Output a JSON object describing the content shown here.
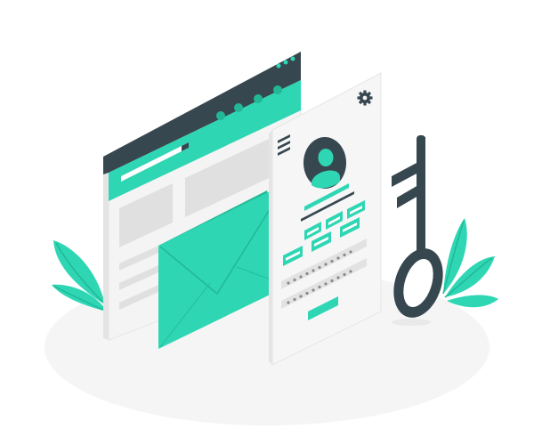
{
  "illustration": {
    "subject": "login-security",
    "colors": {
      "accent": "#2ed6b4",
      "accent_dark": "#21b897",
      "dark": "#37474f",
      "panel": "#f4f4f4",
      "panel_edge": "#e4e4e4",
      "placeholder": "#e0e0e0",
      "ground": "#f5f5f5"
    },
    "icons": [
      "browser-window",
      "envelope-icon",
      "user-avatar-icon",
      "gear-icon",
      "hamburger-menu-icon",
      "key-icon",
      "leaf-plant"
    ],
    "code_boxes": 3,
    "password_dots_per_row": 11
  }
}
